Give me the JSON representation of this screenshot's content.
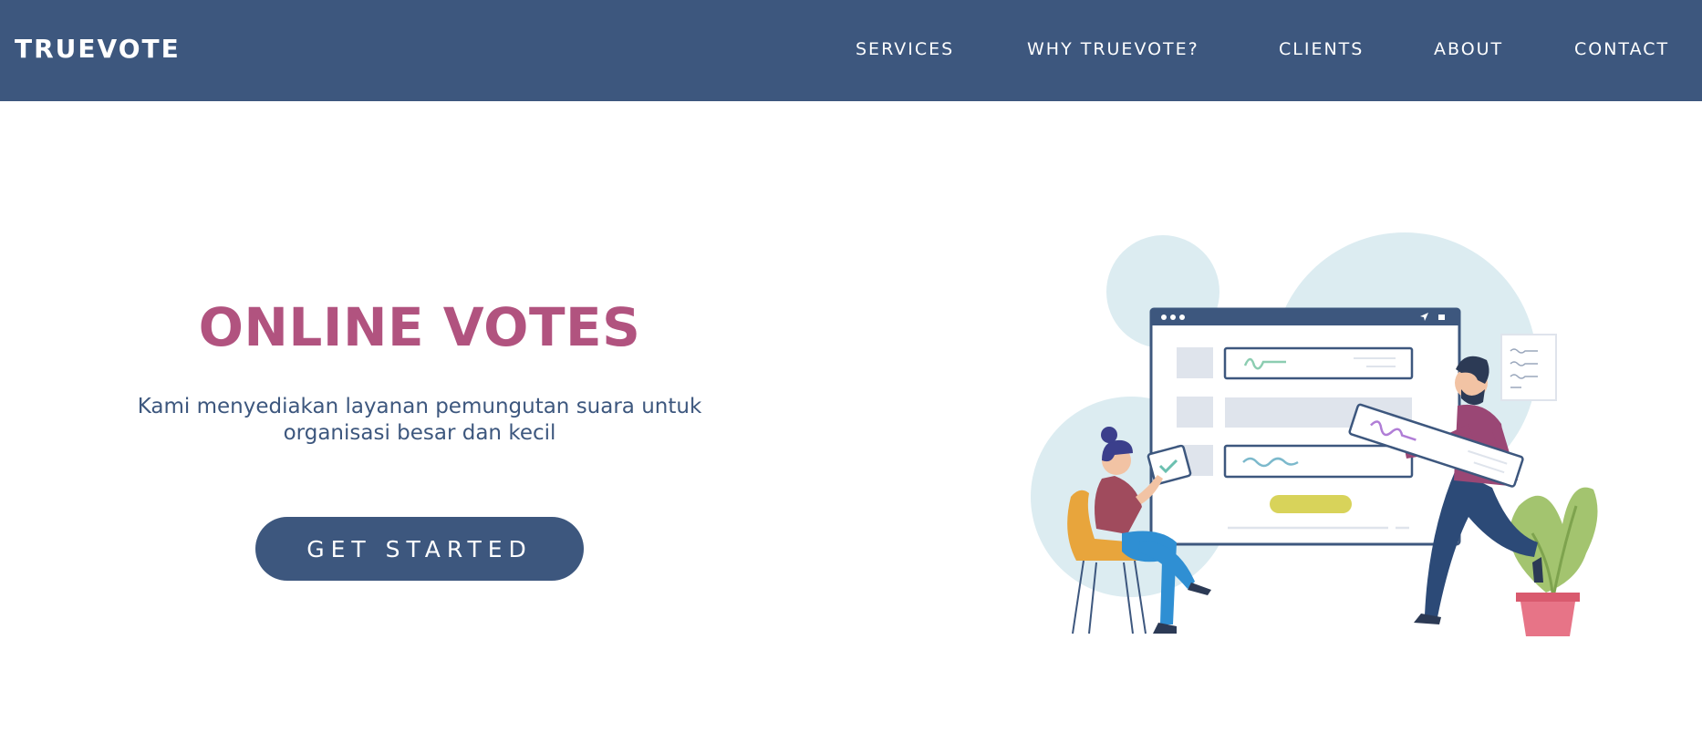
{
  "header": {
    "brand": "TRUEVOTE",
    "nav": {
      "services": "SERVICES",
      "why": "WHY TRUEVOTE?",
      "clients": "CLIENTS",
      "about": "ABOUT",
      "contact": "CONTACT"
    }
  },
  "hero": {
    "title": "ONLINE VOTES",
    "description": "Kami menyediakan layanan pemungutan suara untuk organisasi besar dan kecil",
    "cta_label": "GET STARTED"
  },
  "colors": {
    "primary": "#3d577e",
    "accent": "#b1537f",
    "background": "#ffffff"
  }
}
